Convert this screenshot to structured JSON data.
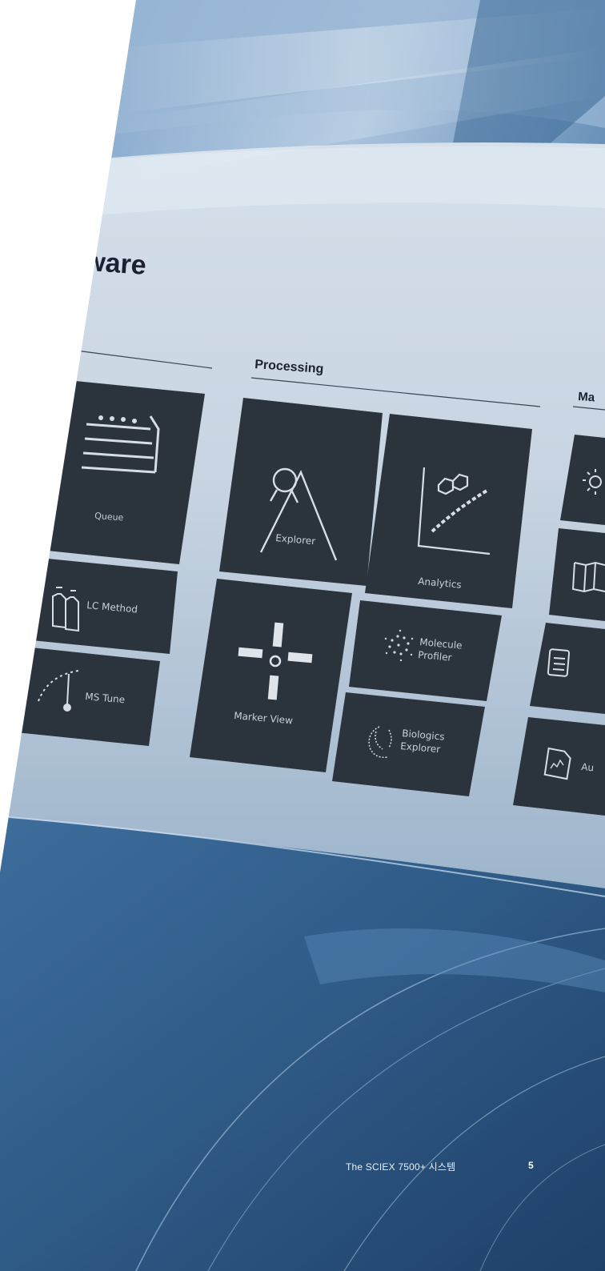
{
  "screen": {
    "title_fragment": "ftware",
    "sections": {
      "processing": "Processing",
      "right_partial": "Ma"
    },
    "tiles": {
      "queue": "Queue",
      "lc_method": "LC Method",
      "ms_tune": "MS Tune",
      "explorer": "Explorer",
      "analytics": "Analytics",
      "marker_view": "Marker View",
      "molecule_profiler_1": "Molecule",
      "molecule_profiler_2": "Profiler",
      "biologics_explorer_1": "Biologics",
      "biologics_explorer_2": "Explorer",
      "partial_au": "Au"
    }
  },
  "footer": {
    "caption": "The SCIEX 7500+ 시스템",
    "page_number": "5"
  },
  "colors": {
    "tile": "#2b333d",
    "screen_light": "#c9d6e3",
    "screen_blue": "#4d7aa6",
    "dark_blue": "#2c537b"
  }
}
